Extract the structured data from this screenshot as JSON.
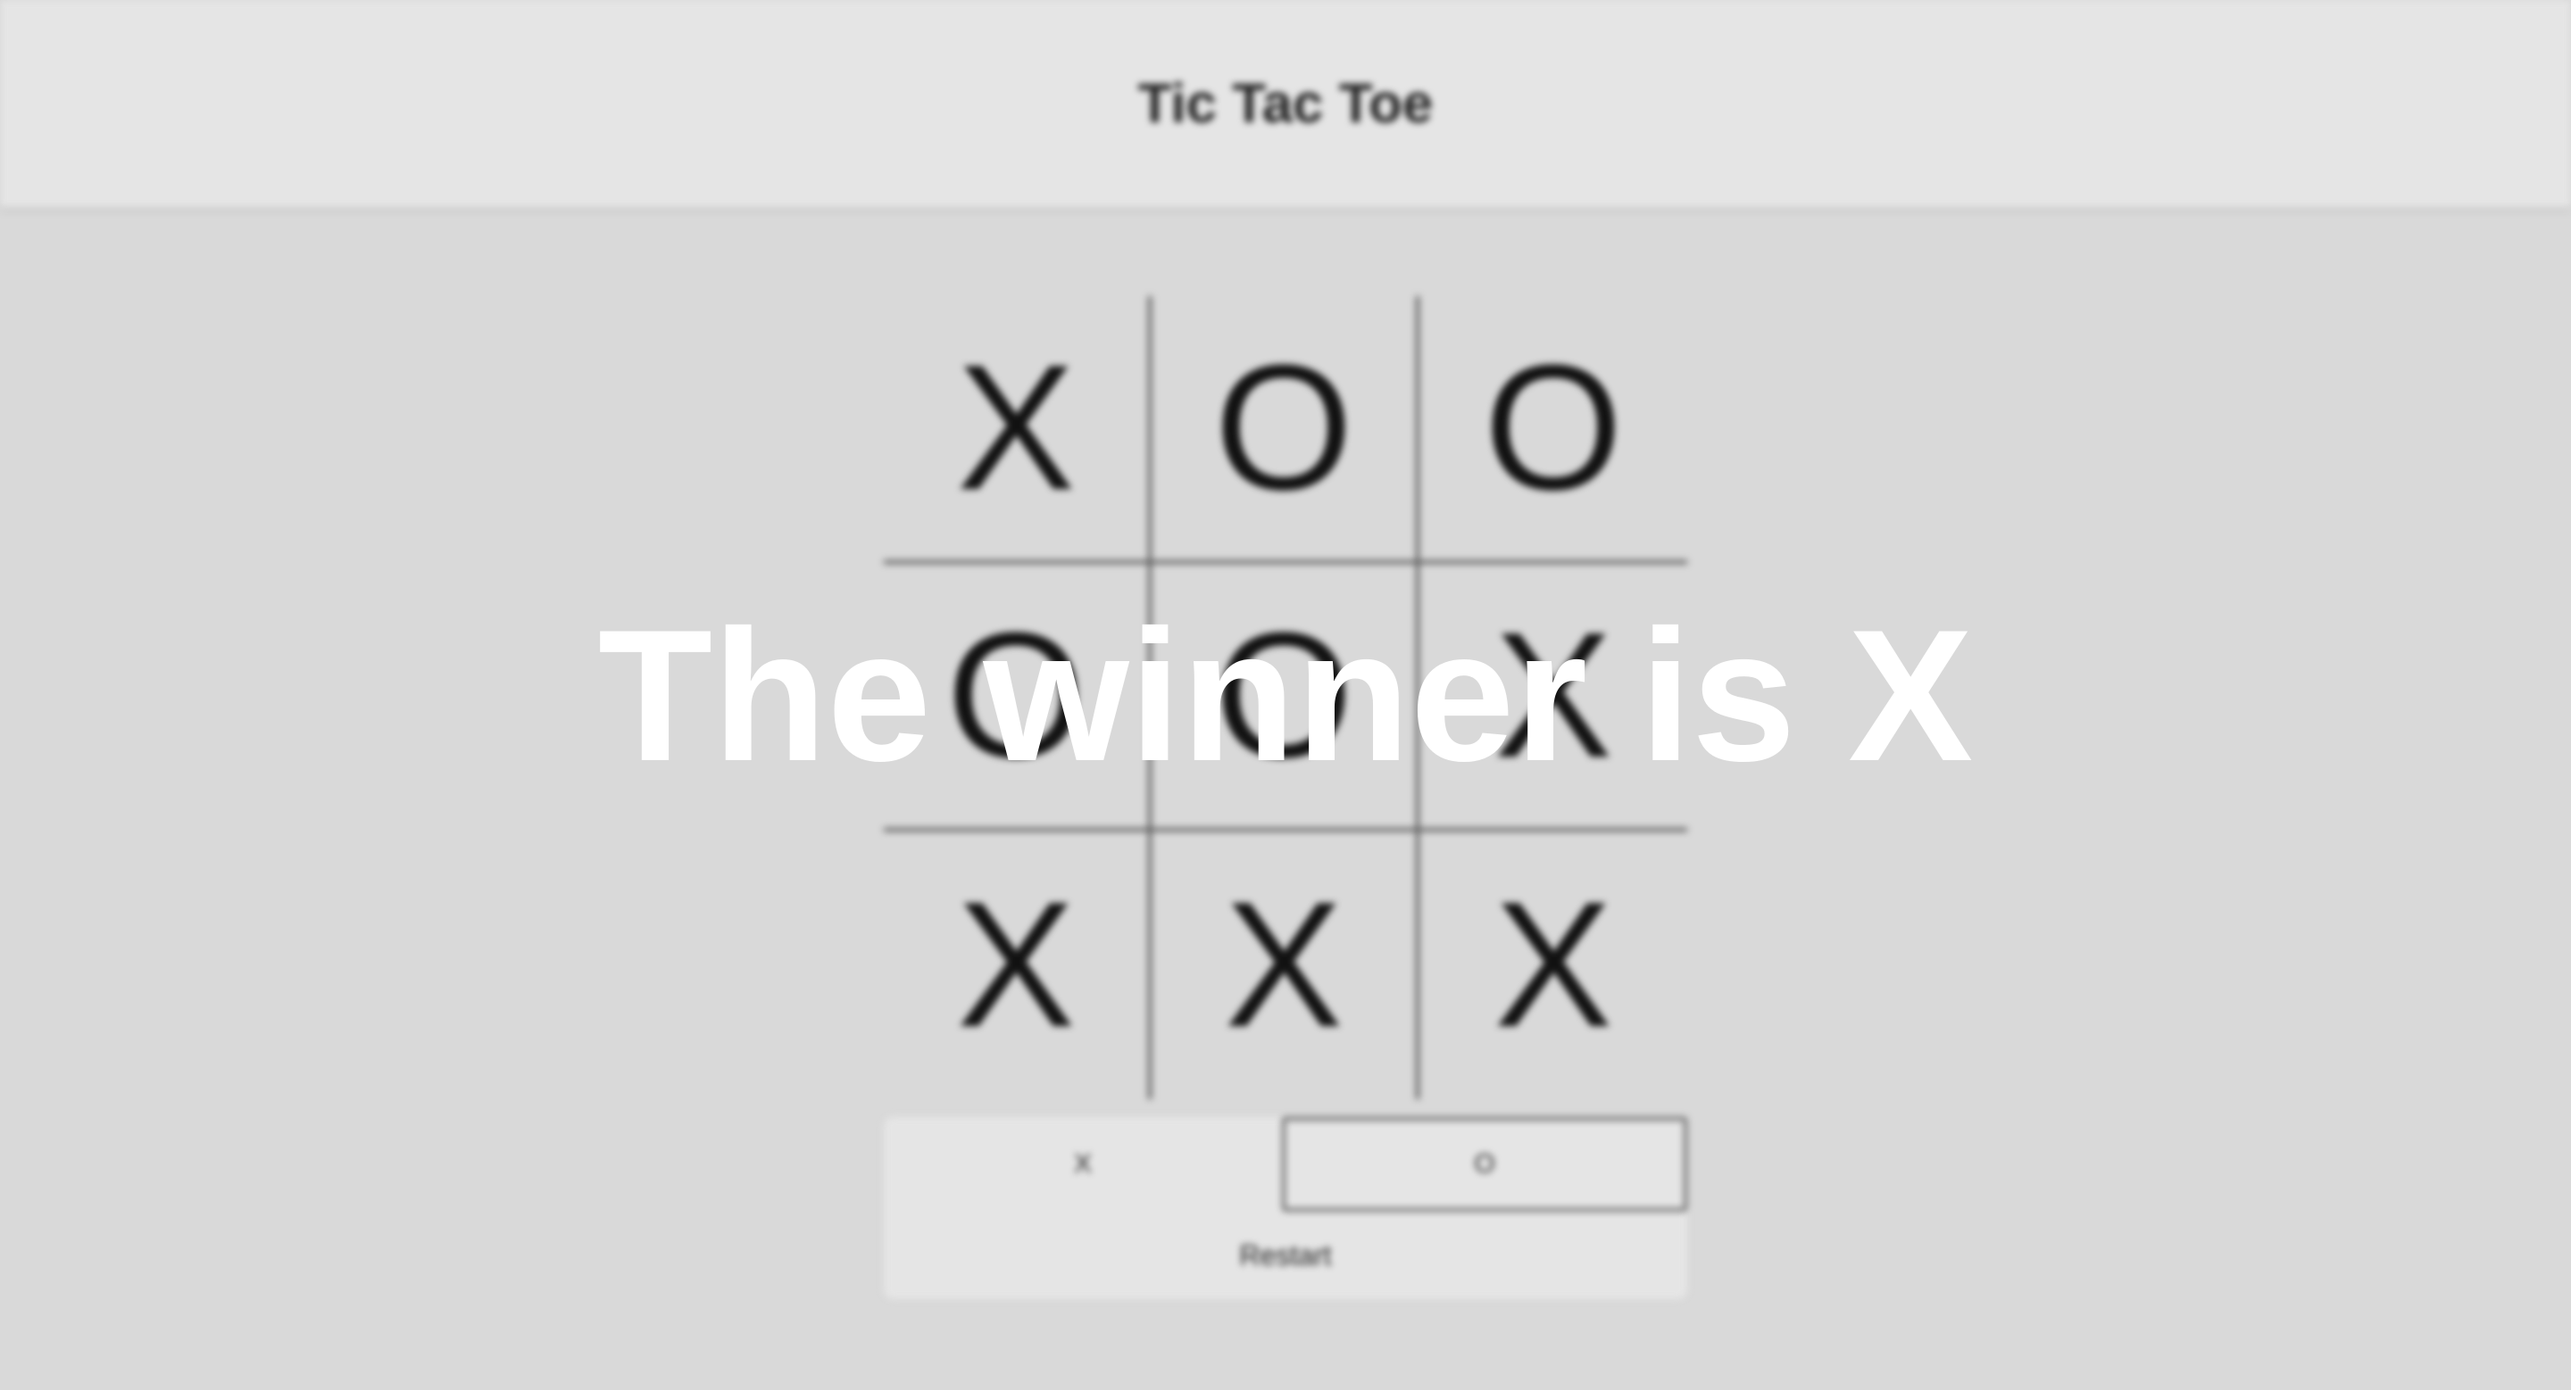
{
  "header": {
    "title": "Tic Tac Toe"
  },
  "board": {
    "cells": [
      "X",
      "O",
      "O",
      "O",
      "O",
      "X",
      "X",
      "X",
      "X"
    ]
  },
  "controls": {
    "player_x_label": "X",
    "player_o_label": "O",
    "active_player": "O",
    "restart_label": "Restart"
  },
  "overlay": {
    "message": "The winner is X"
  },
  "colors": {
    "background": "#d9d9d9",
    "header_background": "#e5e5e5",
    "text": "#222222",
    "overlay_text": "#ffffff"
  }
}
